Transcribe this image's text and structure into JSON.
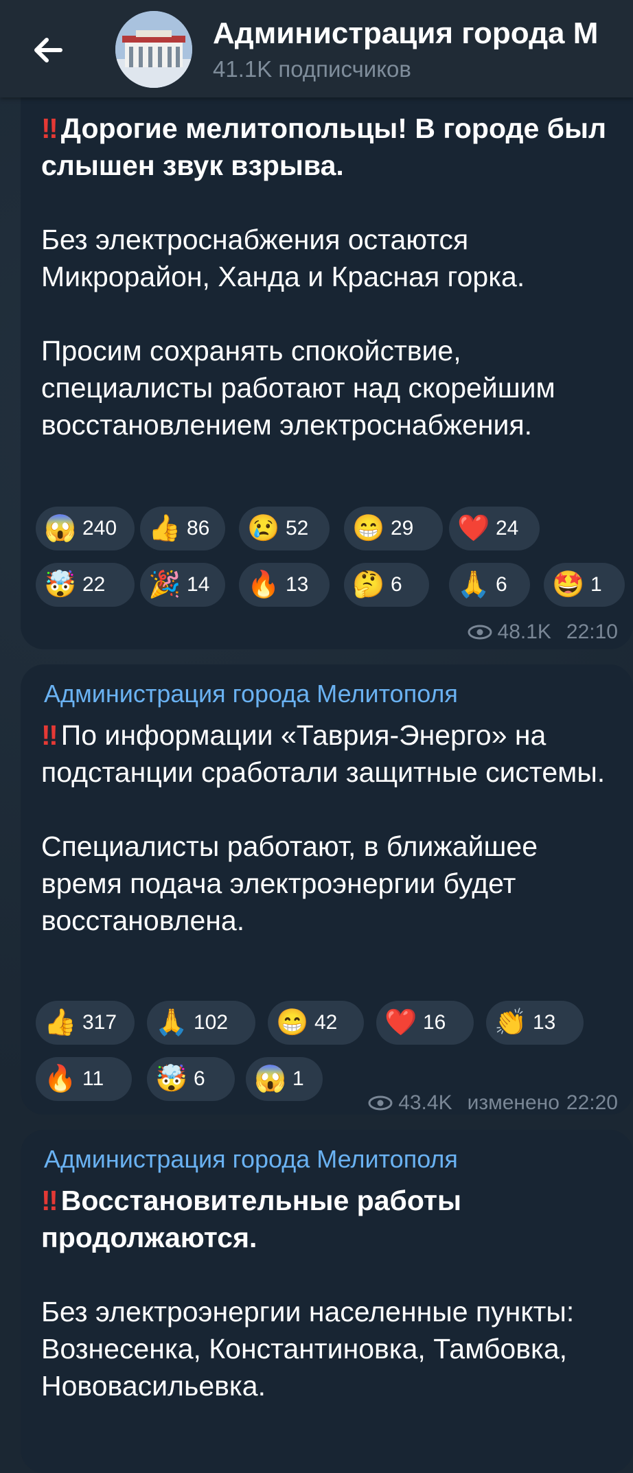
{
  "header": {
    "title": "Администрация города М",
    "subscribers": "41.1K подписчиков"
  },
  "posts": [
    {
      "sender": "",
      "paragraphs": [
        {
          "bold": true,
          "mark": "‼",
          "text": "Дорогие мелитопольцы! В городе был слышен звук взрыва."
        },
        {
          "bold": false,
          "text": "Без электроснабжения остаются Микрорайон, Ханда и Красная горка."
        },
        {
          "bold": false,
          "text": "Просим сохранять спокойствие, специалисты работают над скорейшим восстановлением электроснабжения."
        }
      ],
      "reactions": [
        {
          "emoji": "😱",
          "count": "240"
        },
        {
          "emoji": "👍",
          "count": "86"
        },
        {
          "emoji": "😢",
          "count": "52"
        },
        {
          "emoji": "😁",
          "count": "29"
        },
        {
          "emoji": "❤️",
          "count": "24"
        },
        {
          "emoji": "🤯",
          "count": "22"
        },
        {
          "emoji": "🎉",
          "count": "14"
        },
        {
          "emoji": "🔥",
          "count": "13"
        },
        {
          "emoji": "🤔",
          "count": "6"
        },
        {
          "emoji": "🙏",
          "count": "6"
        },
        {
          "emoji": "🤩",
          "count": "1"
        }
      ],
      "views": "48.1K",
      "edited": "",
      "time": "22:10"
    },
    {
      "sender": "Администрация города Мелитополя",
      "paragraphs": [
        {
          "bold": false,
          "mark": "‼",
          "text": "По информации «Таврия-Энерго» на подстанции сработали защитные системы."
        },
        {
          "bold": false,
          "text": "Специалисты работают, в ближайшее время подача электроэнергии будет восстановлена."
        }
      ],
      "reactions": [
        {
          "emoji": "👍",
          "count": "317"
        },
        {
          "emoji": "🙏",
          "count": "102"
        },
        {
          "emoji": "😁",
          "count": "42"
        },
        {
          "emoji": "❤️",
          "count": "16"
        },
        {
          "emoji": "👏",
          "count": "13"
        },
        {
          "emoji": "🔥",
          "count": "11"
        },
        {
          "emoji": "🤯",
          "count": "6"
        },
        {
          "emoji": "😱",
          "count": "1"
        }
      ],
      "views": "43.4K",
      "edited": "изменено",
      "time": "22:20"
    },
    {
      "sender": "Администрация города Мелитополя",
      "paragraphs": [
        {
          "bold": true,
          "mark": "‼",
          "text": "Восстановительные работы продолжаются."
        },
        {
          "bold": false,
          "text": "Без электроэнергии населенные пункты: Вознесенка, Константиновка, Тамбовка, Нововасильевка."
        }
      ],
      "reactions": [],
      "views": "",
      "edited": "",
      "time": ""
    }
  ],
  "colors": {
    "accent": "#6ab2f2",
    "bubble": "#182533",
    "reaction_bg": "#2b3a4a",
    "header_bg": "#202b36",
    "alert_mark": "#e53935"
  },
  "icons": {
    "back": "arrow-left-icon",
    "views": "eye-icon"
  }
}
